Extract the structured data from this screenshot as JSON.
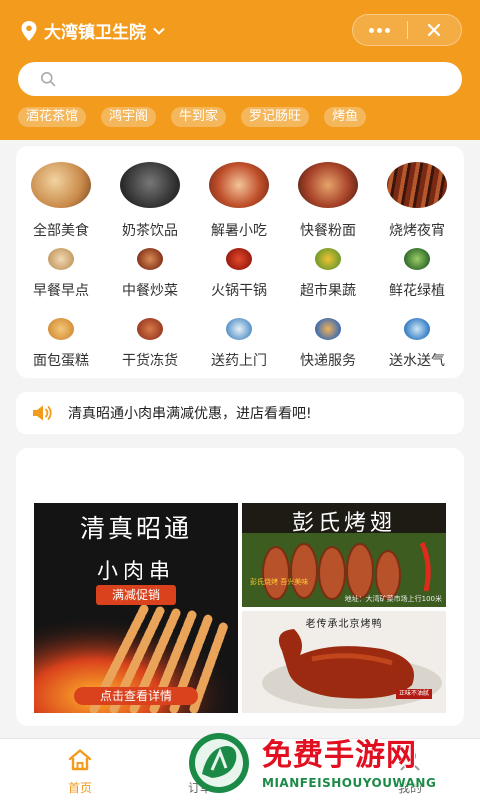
{
  "header": {
    "location": "大湾镇卫生院",
    "search": {
      "placeholder": "",
      "value": ""
    },
    "hot_tags": [
      "酒花茶馆",
      "鸿宇阁",
      "牛到家",
      "罗记肠旺",
      "烤鱼"
    ]
  },
  "categories": [
    {
      "label": "全部美食",
      "icon": "food-plate-photo",
      "color": "#c98a4a"
    },
    {
      "label": "奶茶饮品",
      "icon": "milk-tea-logo-photo",
      "color": "#2b2b2b"
    },
    {
      "label": "解暑小吃",
      "icon": "noodle-bowl-photo",
      "color": "#c0502c"
    },
    {
      "label": "快餐粉面",
      "icon": "fast-food-photo",
      "color": "#a8432a"
    },
    {
      "label": "烧烤夜宵",
      "icon": "bbq-skewers-photo",
      "color": "#7a2a14"
    },
    {
      "label": "早餐早点",
      "icon": "breakfast-photo",
      "color": "#c9a06a"
    },
    {
      "label": "中餐炒菜",
      "icon": "stir-fry-photo",
      "color": "#8a3a1e"
    },
    {
      "label": "火锅干锅",
      "icon": "hotpot-photo",
      "color": "#9e1e12"
    },
    {
      "label": "超市果蔬",
      "icon": "fruit-veg-photo",
      "color": "#6f9a2c"
    },
    {
      "label": "鲜花绿植",
      "icon": "plant-photo",
      "color": "#2f6a2a"
    },
    {
      "label": "面包蛋糕",
      "icon": "bread-photo",
      "color": "#d3913a"
    },
    {
      "label": "干货冻货",
      "icon": "dried-goods-photo",
      "color": "#9a3c22"
    },
    {
      "label": "送药上门",
      "icon": "medicine-photo",
      "color": "#4d8cc4"
    },
    {
      "label": "快递服务",
      "icon": "courier-photo",
      "color": "#3a6ab0"
    },
    {
      "label": "送水送气",
      "icon": "water-delivery-photo",
      "color": "#2f79c2"
    }
  ],
  "notice": {
    "icon": "speaker-icon",
    "text": "清真昭通小肉串满减优惠，进店看看吧!"
  },
  "banners": {
    "promo1": {
      "title": "清真昭通",
      "subtitle": "小肉串",
      "badge": "满减促销",
      "cta": "点击查看详情"
    },
    "promo2": {
      "title": "彭氏烤翅",
      "address": "地址：大湾矿菜市场上行100米",
      "brand": "彭氏烧烤 吾兴美味"
    },
    "promo3": {
      "title": "老传承北京烤鸭",
      "stamp": "正味不油腻"
    }
  },
  "tabbar": {
    "tabs": [
      {
        "label": "首页",
        "icon": "home-icon",
        "active": true
      },
      {
        "label": "订单",
        "icon": "order-icon",
        "active": false
      },
      {
        "label": "",
        "icon": "",
        "active": false
      },
      {
        "label": "我的",
        "icon": "user-icon",
        "active": false
      }
    ]
  },
  "watermark": {
    "main": "免费手游网",
    "sub": "MIANFEISHOUYOUWANG"
  },
  "colors": {
    "brand": "#f29b1d",
    "promo_red": "#d9421c",
    "watermark_red": "#e10f1f",
    "watermark_green": "#1c8a47"
  }
}
